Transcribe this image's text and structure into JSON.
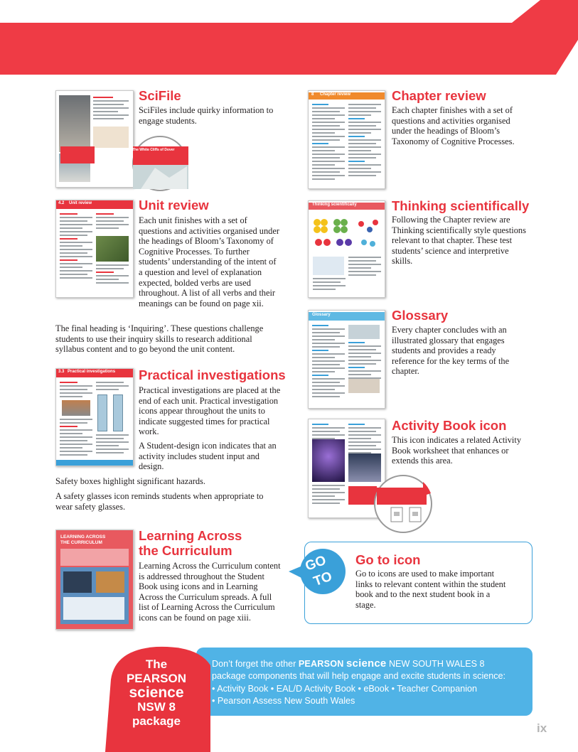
{
  "colors": {
    "accent_red": "#e8343e",
    "accent_blue": "#3aa0d9",
    "bar_blue": "#50b3e6",
    "text": "#231f20",
    "page_number_grey": "#b4b4b4"
  },
  "scifile": {
    "heading": "SciFile",
    "body": "SciFiles include quirky information to engage students.",
    "thumb_callout": "The White Cliffs of Dover"
  },
  "unit_review": {
    "heading": "Unit review",
    "body": "Each unit finishes with a set of questions and activities organised under the headings of Bloom’s Taxonomy of Cognitive Processes. To further students’ understanding of the intent of a question and level of explanation expected, bolded verbs are used throughout. A list of all verbs and their meanings can be found on page xii.",
    "inquiring": "The final heading is ‘Inquiring’. These questions challenge students to use their inquiry skills to research additional syllabus content and to go beyond the unit content.",
    "thumb_label": "4.2",
    "thumb_title": "Unit review"
  },
  "practical": {
    "heading": "Practical investigations",
    "body1": "Practical investigations are placed at the end of each unit. Practical investigation icons appear throughout the units to indicate suggested times for practical work.",
    "body2": "A Student-design icon indicates that an activity includes student input and design.",
    "body3": "Safety boxes highlight significant hazards.",
    "body4": "A safety glasses icon reminds students when appropriate to wear safety glasses.",
    "thumb_label": "3.3",
    "thumb_title": "Practical investigations"
  },
  "learning": {
    "heading_line1": "Learning Across",
    "heading_line2": "the Curriculum",
    "body": "Learning Across the Curriculum content is addressed throughout the Student Book using icons and in Learning Across the Curriculum spreads. A full list of Learning Across the Curriculum icons can be found on page xiii.",
    "thumb_title_line1": "LEARNING ACROSS",
    "thumb_title_line2": "THE CURRICULUM"
  },
  "chapter_review": {
    "heading": "Chapter review",
    "body": "Each chapter finishes with a set of questions and activities organised under the headings of Bloom’s Taxonomy of Cognitive Processes.",
    "thumb_label": "8",
    "thumb_title": "Chapter review"
  },
  "thinking": {
    "heading": "Thinking scientifically",
    "body": "Following the Chapter review are Thinking scientifically style questions relevant to that chapter. These test students’ science and interpretive skills.",
    "thumb_title": "Thinking scientifically"
  },
  "glossary": {
    "heading": "Glossary",
    "body": "Every chapter concludes with an illustrated glossary that engages students and provides a ready reference for the key terms of the chapter.",
    "thumb_title": "Glossary"
  },
  "activity_book": {
    "heading": "Activity Book icon",
    "body": "This icon indicates a related Activity Book worksheet that enhances or extends this area."
  },
  "goto": {
    "badge_line1": "GO",
    "badge_line2": "TO",
    "heading": "Go to icon",
    "body": "Go to icons are used to make important links to relevant content within the student book and to the next student book in a stage."
  },
  "bottom_bar": {
    "line1_pre": "Don’t forget the other",
    "brand_pearson": "PEARSON",
    "brand_science": "science",
    "line1_post": "NEW SOUTH WALES 8",
    "line2": "package components that will help engage and excite students in science:",
    "line3": "• Activity Book  • EAL/D Activity Book  • eBook  • Teacher Companion",
    "line4": "• Pearson Assess New South Wales"
  },
  "package": {
    "line1": "The",
    "line2": "PEARSON",
    "line3": "science",
    "line4": "NSW 8",
    "line5": "package"
  },
  "page_number": "ix"
}
